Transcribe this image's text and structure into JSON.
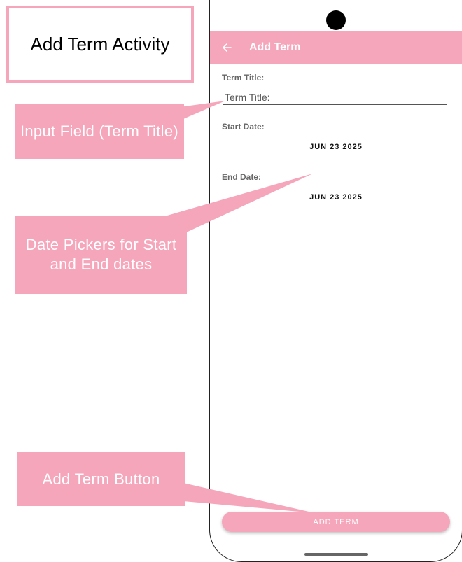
{
  "annotations": {
    "title": "Add Term Activity",
    "input_callout": "Input Field (Term Title)",
    "date_callout": "Date Pickers for Start and End dates",
    "button_callout": "Add Term Button"
  },
  "appbar": {
    "back_icon": "arrow-left-icon",
    "title": "Add Term"
  },
  "form": {
    "term_title_label": "Term Title:",
    "term_title_placeholder": "Term Title:",
    "term_title_value": "",
    "start_date_label": "Start Date:",
    "start_date_value": "JUN 23 2025",
    "end_date_label": "End Date:",
    "end_date_value": "JUN 23 2025"
  },
  "actions": {
    "add_term_label": "ADD TERM"
  },
  "colors": {
    "accent": "#f6a6bb",
    "text_dark": "#111111",
    "label_gray": "#666666"
  }
}
